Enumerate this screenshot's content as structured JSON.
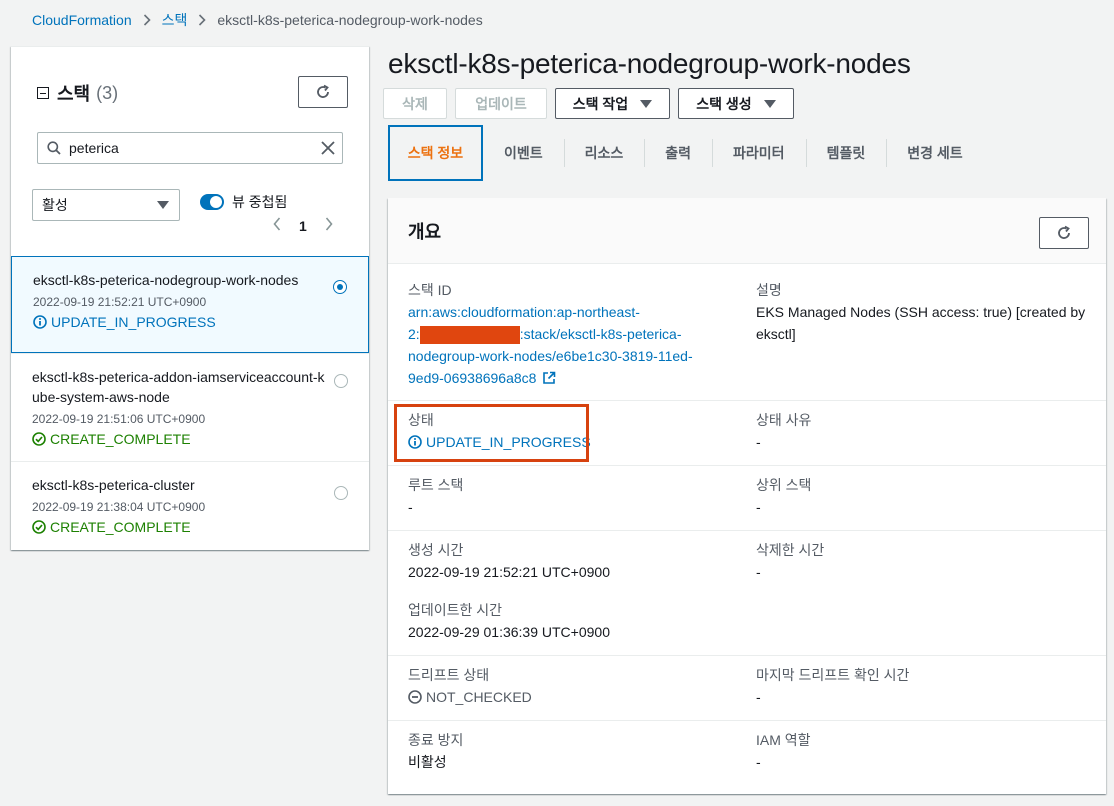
{
  "breadcrumb": {
    "items": [
      "CloudFormation",
      "스택"
    ],
    "current": "eksctl-k8s-peterica-nodegroup-work-nodes"
  },
  "left": {
    "title": "스택",
    "count": "(3)",
    "search_value": "peterica",
    "filter_select": "활성",
    "toggle_label": "뷰 중첩됨",
    "page": "1",
    "stacks": [
      {
        "name": "eksctl-k8s-peterica-nodegroup-work-nodes",
        "time": "2022-09-19 21:52:21 UTC+0900",
        "status": "UPDATE_IN_PROGRESS"
      },
      {
        "name": "eksctl-k8s-peterica-addon-iamserviceaccount-kube-system-aws-node",
        "time": "2022-09-19 21:51:06 UTC+0900",
        "status": "CREATE_COMPLETE"
      },
      {
        "name": "eksctl-k8s-peterica-cluster",
        "time": "2022-09-19 21:38:04 UTC+0900",
        "status": "CREATE_COMPLETE"
      }
    ]
  },
  "main": {
    "title": "eksctl-k8s-peterica-nodegroup-work-nodes",
    "actions": {
      "delete": "삭제",
      "update": "업데이트",
      "stack_actions": "스택 작업",
      "create_stack": "스택 생성"
    },
    "tabs": [
      "스택 정보",
      "이벤트",
      "리소스",
      "출력",
      "파라미터",
      "템플릿",
      "변경 세트"
    ],
    "overview": {
      "heading": "개요",
      "stack_id_label": "스택 ID",
      "stack_id_line1": "arn:aws:cloudformation:ap-northeast-",
      "stack_id_line2_pre": "2:",
      "stack_id_line2_post": ":stack/eksctl-k8s-peterica-",
      "stack_id_line3": "nodegroup-work-nodes/e6be1c30-3819-11ed-",
      "stack_id_line4": "9ed9-06938696a8c8",
      "description_label": "설명",
      "description_value": "EKS Managed Nodes (SSH access: true) [created by eksctl]",
      "status_label": "상태",
      "status_value": "UPDATE_IN_PROGRESS",
      "status_reason_label": "상태 사유",
      "status_reason_value": "-",
      "root_stack_label": "루트 스택",
      "root_stack_value": "-",
      "parent_stack_label": "상위 스택",
      "parent_stack_value": "-",
      "created_label": "생성 시간",
      "created_value": "2022-09-19 21:52:21 UTC+0900",
      "deleted_label": "삭제한 시간",
      "deleted_value": "-",
      "updated_label": "업데이트한 시간",
      "updated_value": "2022-09-29 01:36:39 UTC+0900",
      "drift_label": "드리프트 상태",
      "drift_value": "NOT_CHECKED",
      "last_drift_label": "마지막 드리프트 확인 시간",
      "last_drift_value": "-",
      "termination_label": "종료 방지",
      "termination_value": "비활성",
      "iam_label": "IAM 역할",
      "iam_value": "-"
    }
  },
  "colors": {
    "link": "#0073bb",
    "success": "#1d8102",
    "active_tab": "#ec7211",
    "highlight": "#d7420f"
  }
}
